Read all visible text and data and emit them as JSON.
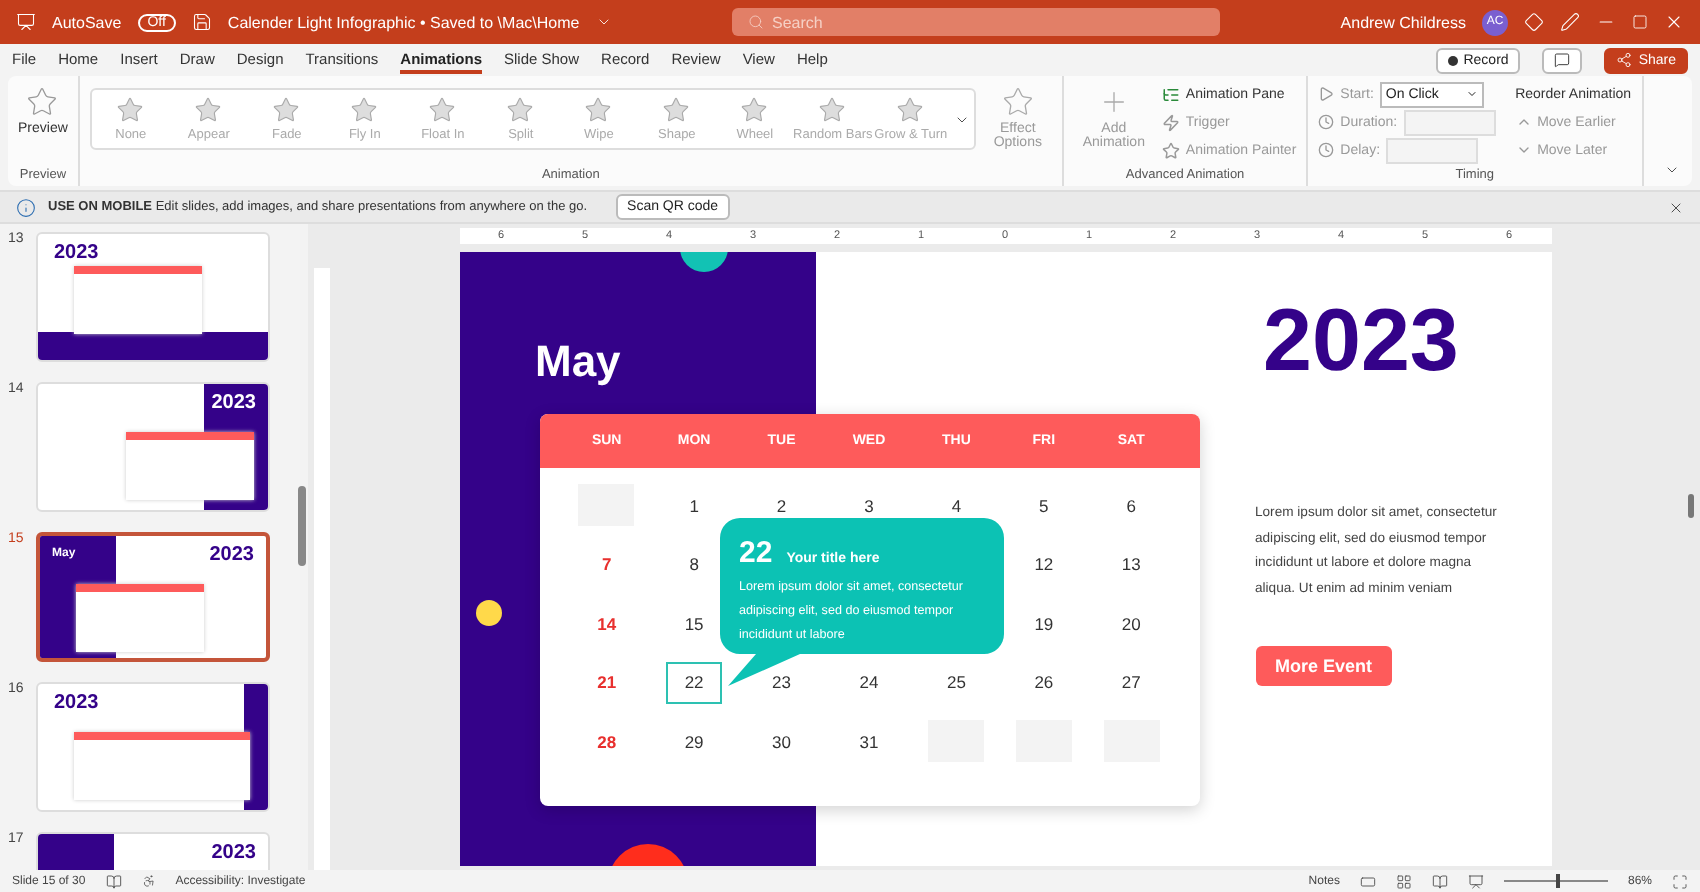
{
  "title_bar": {
    "autosave_label": "AutoSave",
    "autosave_on": false,
    "toggle_text": "Off",
    "document_title": "Calender Light  Infographic • Saved to \\Mac\\Home",
    "search_placeholder": "Search",
    "user_name": "Andrew Childress",
    "avatar_initials": "AC"
  },
  "menu_tabs": [
    {
      "label": "File",
      "selected": false
    },
    {
      "label": "Home",
      "selected": false
    },
    {
      "label": "Insert",
      "selected": false
    },
    {
      "label": "Draw",
      "selected": false
    },
    {
      "label": "Design",
      "selected": false
    },
    {
      "label": "Transitions",
      "selected": false
    },
    {
      "label": "Animations",
      "selected": true
    },
    {
      "label": "Slide Show",
      "selected": false
    },
    {
      "label": "Record",
      "selected": false
    },
    {
      "label": "Review",
      "selected": false
    },
    {
      "label": "View",
      "selected": false
    },
    {
      "label": "Help",
      "selected": false
    }
  ],
  "menu_actions": {
    "record": "Record",
    "share": "Share"
  },
  "ribbon": {
    "preview": {
      "button": "Preview",
      "group": "Preview"
    },
    "gallery": [
      {
        "label": "None",
        "disabled": true
      },
      {
        "label": "Appear",
        "disabled": true
      },
      {
        "label": "Fade",
        "disabled": true
      },
      {
        "label": "Fly In",
        "disabled": true
      },
      {
        "label": "Float In",
        "disabled": true
      },
      {
        "label": "Split",
        "disabled": true
      },
      {
        "label": "Wipe",
        "disabled": true
      },
      {
        "label": "Shape",
        "disabled": true
      },
      {
        "label": "Wheel",
        "disabled": true
      },
      {
        "label": "Random Bars",
        "disabled": true
      },
      {
        "label": "Grow & Turn",
        "disabled": true
      }
    ],
    "effect_options": "Effect Options",
    "animation_group": "Animation",
    "add_animation": "Add Animation",
    "advanced": [
      {
        "label": "Animation Pane",
        "disabled": false
      },
      {
        "label": "Trigger",
        "disabled": true
      },
      {
        "label": "Animation Painter",
        "disabled": true
      }
    ],
    "advanced_group": "Advanced Animation",
    "timing": {
      "start_label": "Start:",
      "start_value": "On Click",
      "duration_label": "Duration:",
      "delay_label": "Delay:",
      "reorder": "Reorder Animation",
      "move_earlier": "Move Earlier",
      "move_later": "Move Later",
      "group": "Timing"
    }
  },
  "info_bar": {
    "text": "**USE ON MOBILE** Edit slides, add images, and share presentations from anywhere on the go.",
    "button": "Scan QR code"
  },
  "thumbnails": [
    {
      "number": "13",
      "kind": "bottom",
      "title": "2023",
      "selected": false
    },
    {
      "number": "14",
      "kind": "right",
      "title": "2023",
      "selected": false
    },
    {
      "number": "15",
      "kind": "left",
      "title": "2023",
      "month": "May",
      "selected": true
    },
    {
      "number": "16",
      "kind": "split",
      "title": "2023",
      "selected": false
    },
    {
      "number": "17",
      "kind": "left",
      "title": "2023",
      "selected": false
    }
  ],
  "ruler": [
    "6",
    "5",
    "4",
    "3",
    "2",
    "1",
    "0",
    "1",
    "2",
    "3",
    "4",
    "5",
    "6"
  ],
  "slide": {
    "month": "May",
    "year": "2023",
    "weekdays": [
      "SUN",
      "MON",
      "TUE",
      "WED",
      "THU",
      "FRI",
      "SAT"
    ],
    "days": [
      {
        "kind": "blank"
      },
      {
        "kind": "day",
        "text": "1",
        "selected": false
      },
      {
        "kind": "day",
        "text": "2",
        "selected": false
      },
      {
        "kind": "day",
        "text": "3",
        "selected": false
      },
      {
        "kind": "day",
        "text": "4",
        "selected": false
      },
      {
        "kind": "day",
        "text": "5",
        "selected": false
      },
      {
        "kind": "day",
        "text": "6",
        "selected": false
      },
      {
        "kind": "day",
        "text": "7",
        "selected": false
      },
      {
        "kind": "day",
        "text": "8",
        "selected": false
      },
      {
        "kind": "covered"
      },
      {
        "kind": "covered"
      },
      {
        "kind": "covered"
      },
      {
        "kind": "day",
        "text": "12",
        "selected": false
      },
      {
        "kind": "day",
        "text": "13",
        "selected": false
      },
      {
        "kind": "day",
        "text": "14",
        "selected": false
      },
      {
        "kind": "day",
        "text": "15",
        "selected": false
      },
      {
        "kind": "covered"
      },
      {
        "kind": "covered"
      },
      {
        "kind": "covered"
      },
      {
        "kind": "day",
        "text": "19",
        "selected": false
      },
      {
        "kind": "day",
        "text": "20",
        "selected": false
      },
      {
        "kind": "day",
        "text": "21",
        "selected": false
      },
      {
        "kind": "day",
        "text": "22",
        "selected": true
      },
      {
        "kind": "day",
        "text": "23",
        "selected": false
      },
      {
        "kind": "day",
        "text": "24",
        "selected": false
      },
      {
        "kind": "day",
        "text": "25",
        "selected": false
      },
      {
        "kind": "day",
        "text": "26",
        "selected": false
      },
      {
        "kind": "day",
        "text": "27",
        "selected": false
      },
      {
        "kind": "day",
        "text": "28",
        "selected": false
      },
      {
        "kind": "day",
        "text": "29",
        "selected": false
      },
      {
        "kind": "day",
        "text": "30",
        "selected": false
      },
      {
        "kind": "day",
        "text": "31",
        "selected": false
      },
      {
        "kind": "blank"
      },
      {
        "kind": "blank"
      },
      {
        "kind": "blank"
      }
    ],
    "callout": {
      "day": "22",
      "title": "Your title here",
      "body": "Lorem ipsum dolor sit amet, consectetur adipiscing elit, sed do eiusmod tempor incididunt ut labore"
    },
    "paragraph": "Lorem ipsum dolor sit amet, consectetur adipiscing elit, sed do eiusmod tempor incididunt ut labore et dolore magna aliqua. Ut enim ad minim veniam",
    "button": "More Event"
  },
  "status_bar": {
    "slide": "Slide 15 of 30",
    "accessibility": "Accessibility: Investigate",
    "notes": "Notes",
    "zoom": "86%",
    "level": 0.5
  }
}
